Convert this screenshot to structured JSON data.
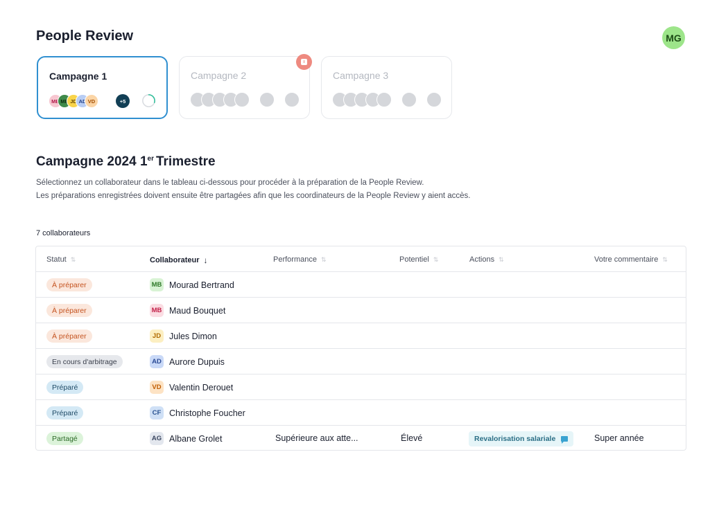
{
  "app": {
    "title": "People Review",
    "user_initials": "MG"
  },
  "campaigns": [
    {
      "label": "Campagne 1",
      "active": true,
      "more": "+5",
      "avatars": [
        {
          "initials": "MB",
          "bg": "#f7c6d0",
          "fg": "#b01848"
        },
        {
          "initials": "ME",
          "bg": "#3f8a4a",
          "fg": "#0e2e12"
        },
        {
          "initials": "JD",
          "bg": "#f9d44a",
          "fg": "#6a4a00"
        },
        {
          "initials": "AD",
          "bg": "#b8cdf4",
          "fg": "#233f85"
        },
        {
          "initials": "VD",
          "bg": "#fbd5a6",
          "fg": "#a34d00"
        }
      ],
      "progress_fraction": 0.3
    },
    {
      "label": "Campagne 2",
      "active": false
    },
    {
      "label": "Campagne 3",
      "active": false
    }
  ],
  "section": {
    "title_main": "Campagne 2024 1",
    "title_sup": "er",
    "title_rest": "Trimestre",
    "desc_line1": "Sélectionnez un collaborateur dans le tableau ci-dessous pour procéder à la préparation de la People Review.",
    "desc_line2": "Les préparations enregistrées doivent ensuite être partagées afin que les coordinateurs de la People Review y aient accès.",
    "count": "7 collaborateurs"
  },
  "table": {
    "columns": [
      "Statut",
      "Collaborateur",
      "Performance",
      "Potentiel",
      "Actions",
      "Votre commentaire"
    ],
    "rows": [
      {
        "status": "À préparer",
        "status_kind": "prepare",
        "initials": "MB",
        "badge_bg": "#d8f3d4",
        "badge_fg": "#2f7a29",
        "name": "Mourad Bertrand",
        "performance": "",
        "potential": "",
        "action": "",
        "comment": ""
      },
      {
        "status": "À préparer",
        "status_kind": "prepare",
        "initials": "MB",
        "badge_bg": "#fbdde3",
        "badge_fg": "#c21f47",
        "name": "Maud Bouquet",
        "performance": "",
        "potential": "",
        "action": "",
        "comment": ""
      },
      {
        "status": "À préparer",
        "status_kind": "prepare",
        "initials": "JD",
        "badge_bg": "#fcefc2",
        "badge_fg": "#b06a00",
        "name": "Jules Dimon",
        "performance": "",
        "potential": "",
        "action": "",
        "comment": ""
      },
      {
        "status": "En cours d'arbitrage",
        "status_kind": "arbitrage",
        "initials": "AD",
        "badge_bg": "#c9d9f7",
        "badge_fg": "#2a4a96",
        "name": "Aurore Dupuis",
        "performance": "",
        "potential": "",
        "action": "",
        "comment": ""
      },
      {
        "status": "Préparé",
        "status_kind": "prepared",
        "initials": "VD",
        "badge_bg": "#fde3c4",
        "badge_fg": "#c05c00",
        "name": "Valentin Derouet",
        "performance": "",
        "potential": "",
        "action": "",
        "comment": ""
      },
      {
        "status": "Préparé",
        "status_kind": "prepared",
        "initials": "CF",
        "badge_bg": "#cfe0f6",
        "badge_fg": "#2a5392",
        "name": "Christophe Foucher",
        "performance": "",
        "potential": "",
        "action": "",
        "comment": ""
      },
      {
        "status": "Partagé",
        "status_kind": "shared",
        "initials": "AG",
        "badge_bg": "#e3e7ee",
        "badge_fg": "#3a4660",
        "name": "Albane Grolet",
        "performance": "Supérieure aux atte...",
        "potential": "Élevé",
        "action": "Revalorisation salariale",
        "comment": "Super année"
      }
    ]
  }
}
